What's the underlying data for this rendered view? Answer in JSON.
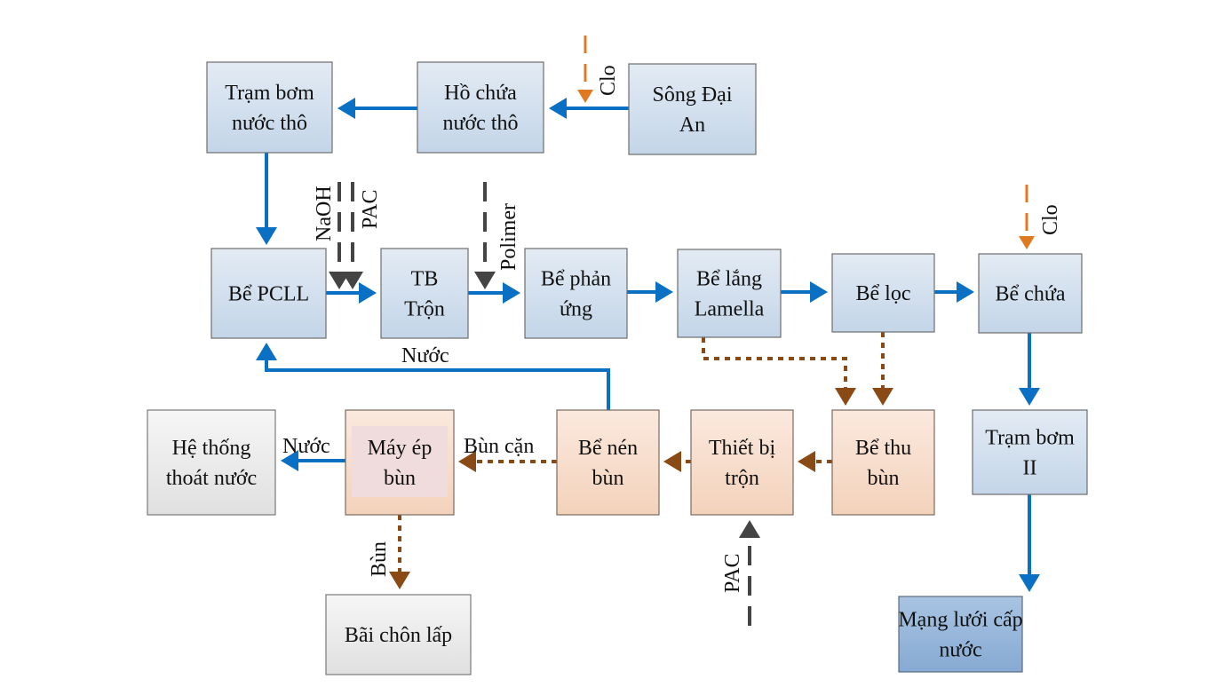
{
  "nodes": {
    "song_dai_an": [
      "Sông Đại",
      "An"
    ],
    "ho_chua": [
      "Hồ chứa",
      "nước thô"
    ],
    "tram_bom_tho": [
      "Trạm bơm",
      "nước thô"
    ],
    "be_pcll": [
      "Bể PCLL"
    ],
    "tb_tron": [
      "TB",
      "Trộn"
    ],
    "be_phan_ung": [
      "Bể phản",
      "ứng"
    ],
    "be_lang": [
      "Bể lắng",
      "Lamella"
    ],
    "be_loc": [
      "Bể lọc"
    ],
    "be_chua": [
      "Bể chứa"
    ],
    "tram_bom_2": [
      "Trạm bơm",
      "II"
    ],
    "mang_luoi": [
      "Mạng lưới cấp",
      "nước"
    ],
    "be_thu_bun": [
      "Bể thu",
      "bùn"
    ],
    "thiet_bi_tron": [
      "Thiết bị",
      "trộn"
    ],
    "be_nen_bun": [
      "Bể nén",
      "bùn"
    ],
    "may_ep_bun": [
      "Máy ép",
      "bùn"
    ],
    "he_thong_thoat": [
      "Hệ thống",
      "thoát nước"
    ],
    "bai_chon_lap": [
      "Bãi chôn lấp"
    ]
  },
  "labels": {
    "clo_top": "Clo",
    "naoh": "NaOH",
    "pac_top": "PAC",
    "polimer": "Polimer",
    "clo_right": "Clo",
    "nuoc_return": "Nước",
    "bun_can": "Bùn cặn",
    "nuoc_out": "Nước",
    "bun": "Bùn",
    "pac_bottom": "PAC"
  },
  "colors": {
    "water_flow": "#0a70c4",
    "sludge_flow": "#8a4a16",
    "chemical": "#444444",
    "chlorine": "#e07a20"
  }
}
